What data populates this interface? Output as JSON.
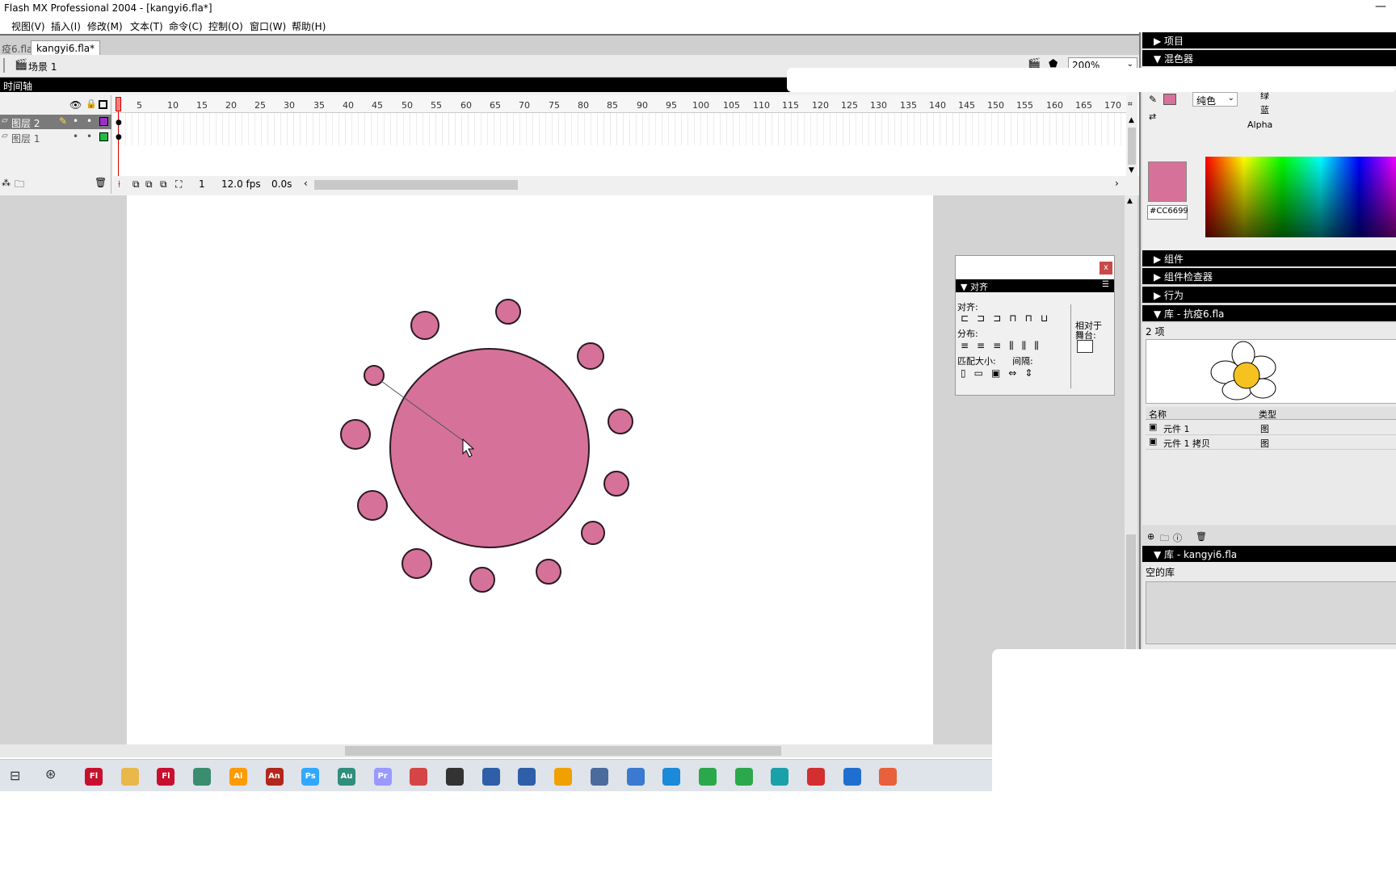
{
  "window": {
    "title": "Flash MX Professional 2004 - [kangyi6.fla*]",
    "minimize": "—"
  },
  "menu": [
    "视图(V)",
    "插入(I)",
    "修改(M)",
    "文本(T)",
    "命令(C)",
    "控制(O)",
    "窗口(W)",
    "帮助(H)"
  ],
  "doc_tabs": {
    "inactive": "疫6.fla",
    "active": "kangyi6.fla*"
  },
  "scene": {
    "label": "场景 1",
    "zoom": "200%"
  },
  "timeline": {
    "title": "时间轴",
    "ruler": [
      "5",
      "10",
      "15",
      "20",
      "25",
      "30",
      "35",
      "40",
      "45",
      "50",
      "55",
      "60",
      "65",
      "70",
      "75",
      "80",
      "85",
      "90",
      "95",
      "100",
      "105",
      "110",
      "115",
      "120",
      "125",
      "130",
      "135",
      "140",
      "145",
      "150",
      "155",
      "160",
      "165",
      "170"
    ],
    "layers": [
      {
        "name": "图层 2",
        "color": "#9b30c8"
      },
      {
        "name": "图层 1",
        "color": "#22bb44"
      }
    ],
    "current_frame": "1",
    "fps": "12.0 fps",
    "elapsed": "0.0s"
  },
  "stage": {
    "fill": "#D6729A",
    "stroke": "#2a1a22"
  },
  "align_panel": {
    "title": "对齐",
    "align_label": "对齐:",
    "distribute_label": "分布:",
    "match_size_label": "匹配大小:",
    "spacing_label": "间隔:",
    "relative_label": "相对于",
    "stage_label": "舞台:",
    "close": "x"
  },
  "dock": {
    "project": "项目",
    "mixer": "混色器",
    "fill_type": "纯色",
    "channels": [
      "绿",
      "蓝",
      "Alpha"
    ],
    "hex": "#CC6699",
    "swatch_color": "#D6729A",
    "components": "组件",
    "component_inspector": "组件检查器",
    "behaviors": "行为",
    "library1": {
      "title": "库 - 抗疫6.fla",
      "count": "2 项",
      "col_name": "名称",
      "col_type": "类型",
      "items": [
        "元件 1",
        "元件 1 拷贝"
      ],
      "item_type": "图"
    },
    "library2": {
      "title": "库 - kangyi6.fla",
      "empty": "空的库"
    }
  },
  "taskbar": [
    {
      "name": "Fl",
      "color": "#c8102e"
    },
    {
      "name": "",
      "color": "#e8b84a"
    },
    {
      "name": "Fl",
      "color": "#c8102e"
    },
    {
      "name": "",
      "color": "#3a8d6e"
    },
    {
      "name": "Ai",
      "color": "#ff9a00"
    },
    {
      "name": "An",
      "color": "#b3261e"
    },
    {
      "name": "Ps",
      "color": "#31a8ff"
    },
    {
      "name": "Au",
      "color": "#2f8e7c"
    },
    {
      "name": "Pr",
      "color": "#9999ff"
    },
    {
      "name": "",
      "color": "#d64545"
    },
    {
      "name": "",
      "color": "#333333"
    },
    {
      "name": "",
      "color": "#2f5fa8"
    },
    {
      "name": "",
      "color": "#2f5fa8"
    },
    {
      "name": "",
      "color": "#f0a000"
    },
    {
      "name": "",
      "color": "#4a6b9c"
    },
    {
      "name": "",
      "color": "#3a7ad0"
    },
    {
      "name": "",
      "color": "#1b8ad8"
    },
    {
      "name": "",
      "color": "#2ba84a"
    },
    {
      "name": "",
      "color": "#2ba84a"
    },
    {
      "name": "",
      "color": "#1aa0a8"
    },
    {
      "name": "",
      "color": "#d32f2f"
    },
    {
      "name": "",
      "color": "#1f6fd1"
    },
    {
      "name": "",
      "color": "#e8603c"
    }
  ]
}
